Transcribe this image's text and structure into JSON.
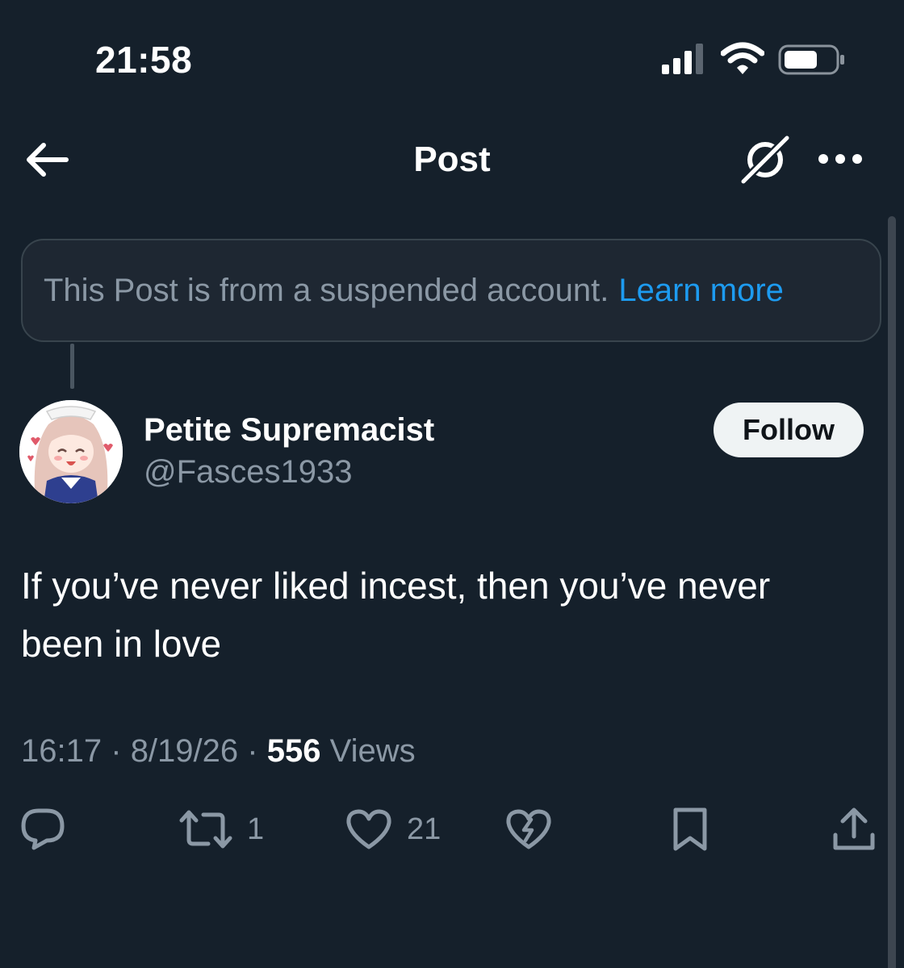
{
  "status_bar": {
    "time": "21:58",
    "signal_icon": "cellular-signal-icon",
    "wifi_icon": "wifi-icon",
    "battery_icon": "battery-icon"
  },
  "header": {
    "back_icon": "arrow-left-icon",
    "title": "Post",
    "grok_icon": "grok-icon",
    "more_icon": "more-horizontal-icon"
  },
  "notice": {
    "text": "This Post is from a suspended account.",
    "link": "Learn more"
  },
  "author": {
    "display_name": "Petite Supremacist",
    "handle": "@Fasces1933",
    "follow_label": "Follow"
  },
  "post": {
    "text": "If you’ve never liked incest, then you’ve never been in love",
    "time": "16:17",
    "date": "8/19/26",
    "separator": "·",
    "views_count": "556",
    "views_label": "Views"
  },
  "actions": {
    "reply_icon": "reply-icon",
    "repost_icon": "repost-icon",
    "repost_count": "1",
    "like_icon": "heart-icon",
    "like_count": "21",
    "dislike_icon": "broken-heart-icon",
    "bookmark_icon": "bookmark-icon",
    "share_icon": "share-icon"
  },
  "colors": {
    "background": "#15202b",
    "secondary_text": "#8b98a5",
    "link": "#1d9bf0",
    "follow_button": "#eff3f4"
  }
}
